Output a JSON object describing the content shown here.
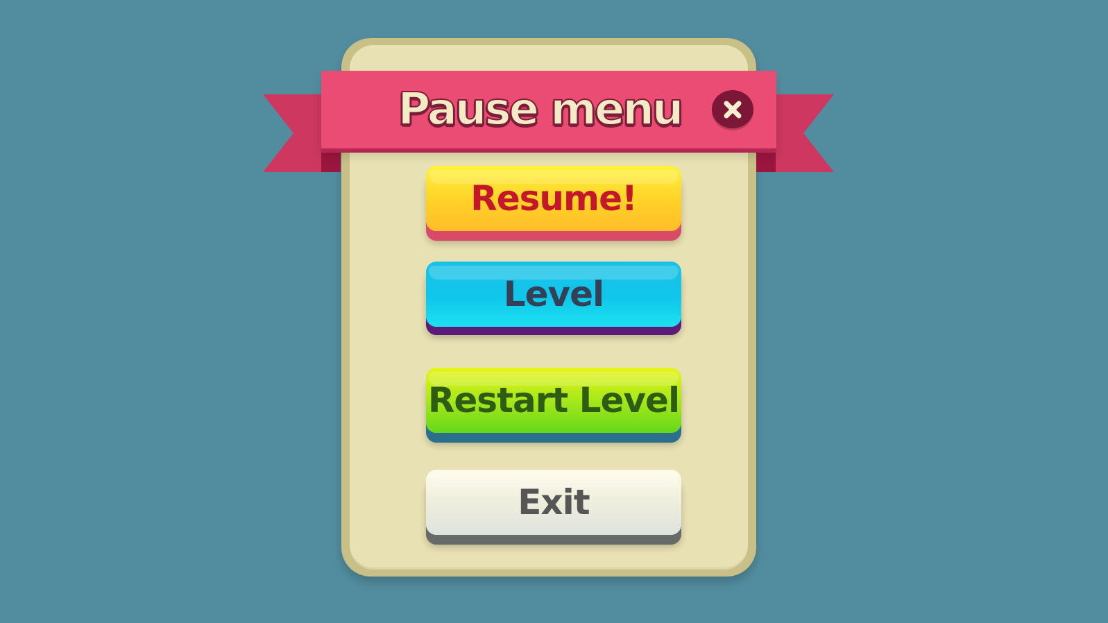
{
  "dialog": {
    "title": "Pause menu",
    "close_icon": "close-icon",
    "buttons": [
      {
        "label": "Resume!",
        "color": "#ffd128"
      },
      {
        "label": "Level",
        "color": "#10c6eb"
      },
      {
        "label": "Restart Level",
        "color": "#a8e81a"
      },
      {
        "label": "Exit",
        "color": "#eeeedc"
      }
    ]
  },
  "colors": {
    "background": "#528d9f",
    "panel": "#e8e1b3",
    "ribbon": "#eb4c74"
  }
}
